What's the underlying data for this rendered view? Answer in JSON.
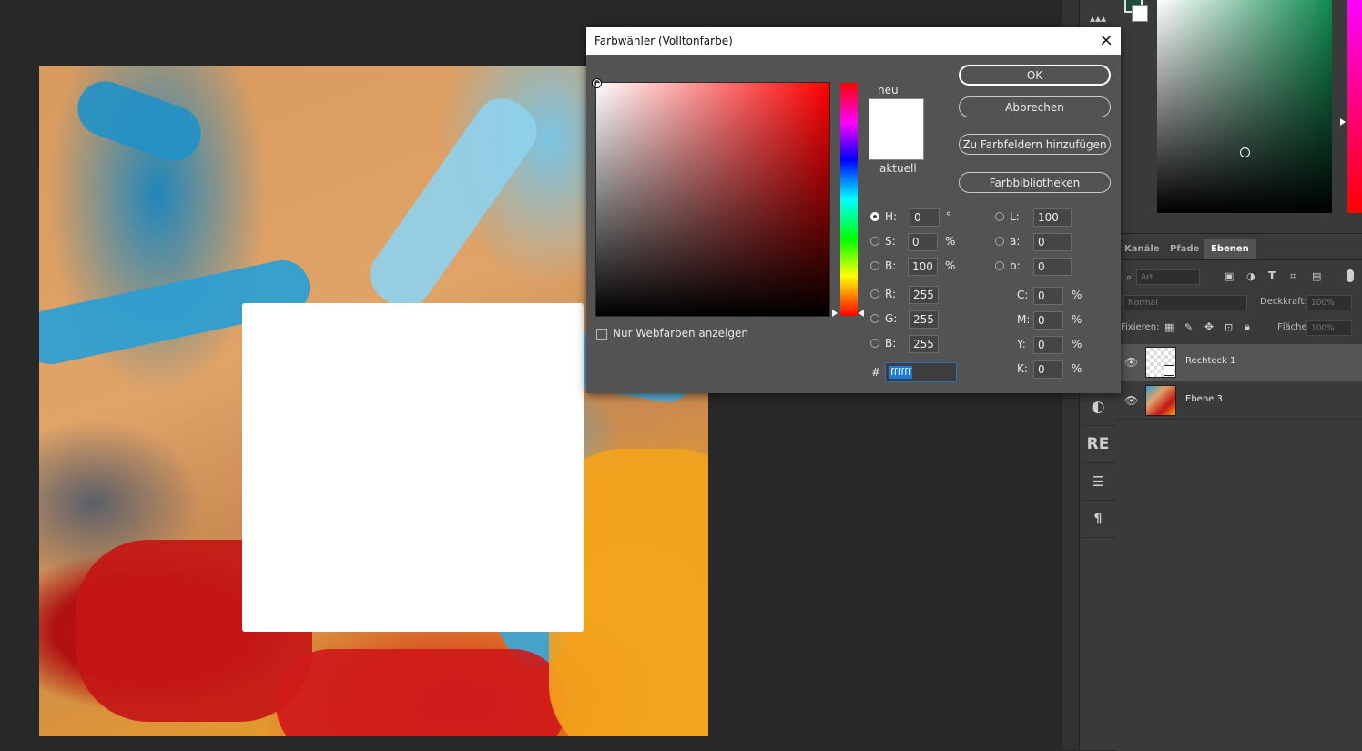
{
  "dialog": {
    "title": "Farbwähler (Volltonfarbe)",
    "close_icon": "×",
    "new_label": "neu",
    "current_label": "aktuell",
    "buttons": {
      "ok": "OK",
      "cancel": "Abbrechen",
      "add_swatch": "Zu Farbfeldern hinzufügen",
      "libraries": "Farbbibliotheken"
    },
    "web_colors_label": "Nur Webfarben anzeigen",
    "fields": {
      "H": {
        "label": "H:",
        "value": "0",
        "unit": "°"
      },
      "S": {
        "label": "S:",
        "value": "0",
        "unit": "%"
      },
      "B": {
        "label": "B:",
        "value": "100",
        "unit": "%"
      },
      "R": {
        "label": "R:",
        "value": "255"
      },
      "G": {
        "label": "G:",
        "value": "255"
      },
      "Bl": {
        "label": "B:",
        "value": "255"
      },
      "L": {
        "label": "L:",
        "value": "100"
      },
      "a": {
        "label": "a:",
        "value": "0"
      },
      "b": {
        "label": "b:",
        "value": "0"
      },
      "C": {
        "label": "C:",
        "value": "0",
        "unit": "%"
      },
      "M": {
        "label": "M:",
        "value": "0",
        "unit": "%"
      },
      "Y": {
        "label": "Y:",
        "value": "0",
        "unit": "%"
      },
      "K": {
        "label": "K:",
        "value": "0",
        "unit": "%"
      }
    },
    "hex_hash": "#",
    "hex_value": "ffffff",
    "new_color": "#ffffff"
  },
  "layers_panel": {
    "tabs": [
      "Kanäle",
      "Pfade",
      "Ebenen"
    ],
    "active_tab": "Ebenen",
    "filter_placeholder": "Art",
    "blend_mode": "Normal",
    "opacity_label": "Deckkraft:",
    "opacity_value": "100%",
    "lock_label": "Fixieren:",
    "fill_label": "Fläche:",
    "fill_value": "100%",
    "layers": [
      {
        "name": "Rechteck 1",
        "selected": true
      },
      {
        "name": "Ebene 3",
        "selected": false
      }
    ]
  },
  "toolbar": {
    "re_label": "RE"
  },
  "colors": {
    "foreground": "#1f4d3a",
    "background": "#ffffff"
  }
}
